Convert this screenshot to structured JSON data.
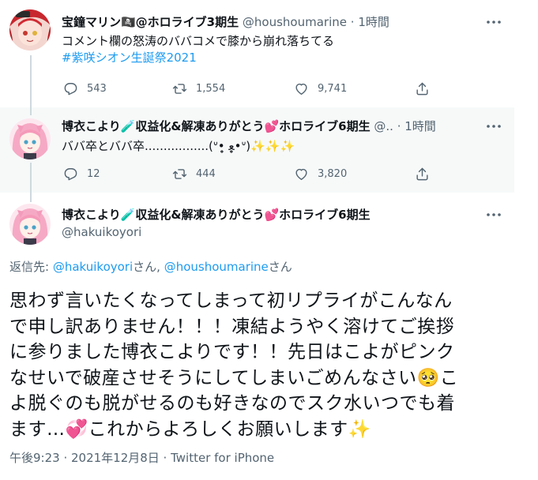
{
  "tweets": [
    {
      "name": "宝鐘マリン🏴‍☠️@ホロライブ3期生",
      "handle": "@houshoumarine",
      "sep": "·",
      "time": "1時間",
      "text": "コメント欄の怒涛のババコメで膝から崩れ落ちてる",
      "hashtag": "#紫咲シオン生誕祭2021",
      "replies": "543",
      "retweets": "1,554",
      "likes": "9,741"
    },
    {
      "name": "博衣こより🧪収益化&解凍ありがとう💕ホロライブ6期生",
      "handle": "@..",
      "sep": "·",
      "time": "1時間",
      "text": "ババ卒とババ卒.................(ᐡ•̥̥̥ ﻌ•̥̥̥ᐡ)✨✨✨",
      "replies": "12",
      "retweets": "444",
      "likes": "3,820"
    }
  ],
  "main_tweet": {
    "name": "博衣こより🧪収益化&解凍ありがとう💕ホロライブ6期生",
    "handle": "@hakuikoyori",
    "reply_prefix": "返信先: ",
    "mention1": "@hakuikoyori",
    "san1": "さん, ",
    "mention2": "@houshoumarine",
    "san2": "さん",
    "lines": [
      "思わず言いたくなってしまって初リプライがこんなん",
      "で申し訳ありません！！！凍結ようやく溶けてご挨拶",
      "に参りました博衣こよりです！！先日はこよがピンク",
      "なせいで破産させそうにしてしまいごめんなさい🥺こ",
      "よ脱ぐのも脱がせるのも好きなのでスク水いつでも着",
      "ます…💞これからよろしくお願いします✨"
    ],
    "meta": "午後9:23 · 2021年12月8日 · Twitter for iPhone"
  },
  "colors": {
    "accent": "#1d9bf0",
    "muted": "#536471",
    "text": "#0f1419",
    "reply_bg": "#f7f9f9"
  },
  "icons": [
    "reply-icon",
    "retweet-icon",
    "like-icon",
    "share-icon",
    "more-icon"
  ]
}
